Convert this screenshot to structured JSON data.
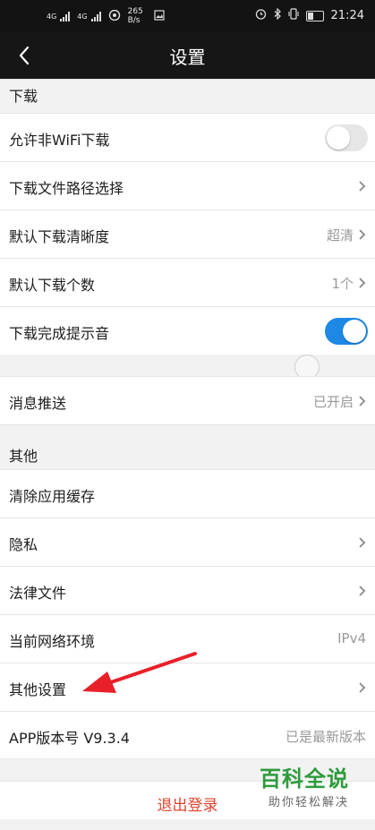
{
  "status_bar": {
    "network_1": "4G",
    "network_2": "4G",
    "speed_value": "265",
    "speed_unit": "B/s",
    "time": "21:24"
  },
  "nav": {
    "title": "设置",
    "back_icon": "chevron-left-icon"
  },
  "sections": {
    "download_header": "下载",
    "other_header": "其他"
  },
  "download": {
    "non_wifi_label": "允许非WiFi下载",
    "non_wifi_enabled": false,
    "path_label": "下载文件路径选择",
    "clarity_label": "默认下载清晰度",
    "clarity_value": "超清",
    "count_label": "默认下载个数",
    "count_value": "1个",
    "sound_label": "下载完成提示音",
    "sound_enabled": true
  },
  "push": {
    "label": "消息推送",
    "value": "已开启"
  },
  "other": {
    "cache_label": "清除应用缓存",
    "privacy_label": "隐私",
    "legal_label": "法律文件",
    "network_label": "当前网络环境",
    "network_value": "IPv4",
    "more_label": "其他设置",
    "version_label": "APP版本号 V9.3.4",
    "version_value": "已是最新版本"
  },
  "logout_label": "退出登录",
  "watermark": {
    "line1": "百科全说",
    "line2": "助你轻松解决"
  },
  "colors": {
    "accent": "#1e88e5",
    "logout": "#e2432d",
    "annotation_arrow": "#e8202a"
  }
}
